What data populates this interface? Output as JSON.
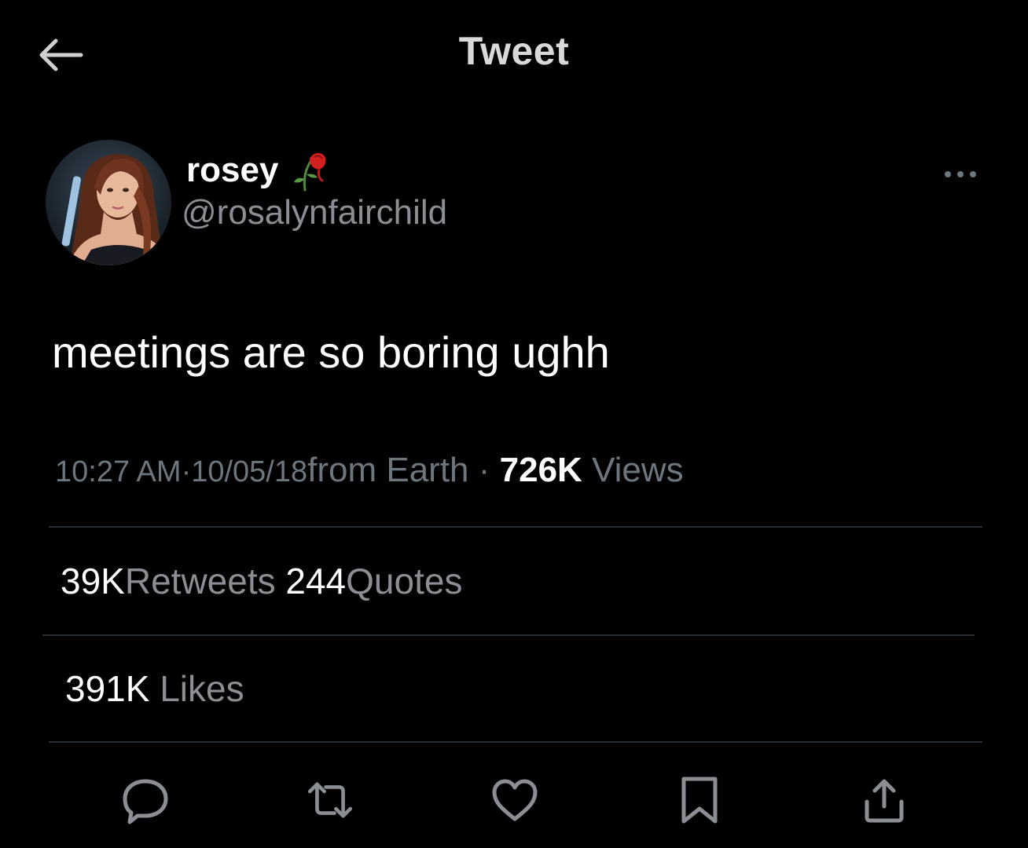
{
  "header": {
    "title": "Tweet",
    "back_icon": "arrow-left-icon"
  },
  "author": {
    "display_name": "rosey",
    "name_emoji_icon": "wilted-rose-icon",
    "handle": "@rosalynfairchild",
    "more_icon": "more-horizontal-icon"
  },
  "tweet": {
    "text": "meetings are so boring ughh"
  },
  "meta": {
    "time": "10:27 AM",
    "date": "10/05/18",
    "source": "from Earth",
    "views_count": "726K",
    "views_label": "Views"
  },
  "stats": {
    "retweets_count": "39K",
    "retweets_label": "Retweets",
    "quotes_count": "244",
    "quotes_label": "Quotes",
    "likes_count": "391K",
    "likes_label": "Likes"
  },
  "actions": [
    "reply-icon",
    "retweet-icon",
    "like-icon",
    "bookmark-icon",
    "share-icon"
  ],
  "colors": {
    "background": "#000000",
    "text_primary": "#ffffff",
    "text_secondary": "#8b8e93",
    "divider": "#2a2d30"
  }
}
